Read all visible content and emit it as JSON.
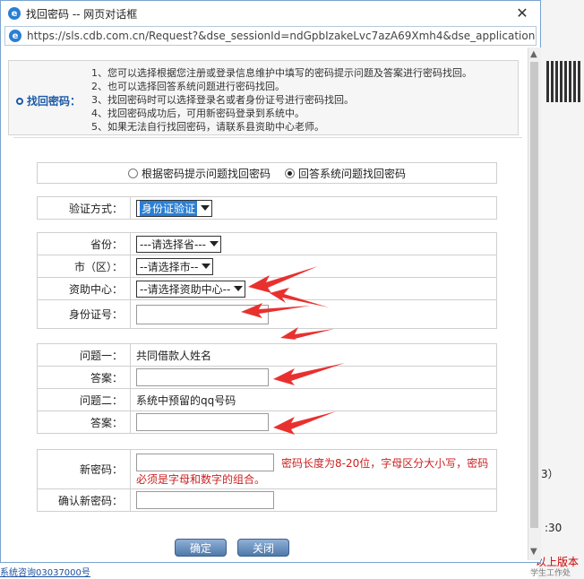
{
  "window": {
    "title": "找回密码 -- 网页对话框",
    "close_label": "✕",
    "url": "https://sls.cdb.com.cn/Request?&dse_sessionId=ndGpbIzakeLvc7azA69Xmh4&dse_applicationId="
  },
  "tips": {
    "label": "找回密码：",
    "items": [
      "1、您可以选择根据您注册或登录信息维护中填写的密码提示问题及答案进行密码找回。",
      "2、也可以选择回答系统问题进行密码找回。",
      "3、找回密码时可以选择登录名或者身份证号进行密码找回。",
      "4、找回密码成功后，可用新密码登录到系统中。",
      "5、如果无法自行找回密码，请联系县资助中心老师。"
    ]
  },
  "mode": {
    "option1": "根据密码提示问题找回密码",
    "option2": "回答系统问题找回密码",
    "selected": 2
  },
  "verify": {
    "label": "验证方式：",
    "value": "身份证验证"
  },
  "location": {
    "province_label": "省份：",
    "province_value": "---请选择省---",
    "city_label": "市（区）：",
    "city_value": "--请选择市--",
    "center_label": "资助中心：",
    "center_value": "--请选择资助中心--",
    "id_label": "身份证号："
  },
  "questions": {
    "q1_label": "问题一：",
    "q1_text": "共同借款人姓名",
    "a1_label": "答案：",
    "q2_label": "问题二：",
    "q2_text": "系统中预留的qq号码",
    "a2_label": "答案："
  },
  "password": {
    "new_label": "新密码：",
    "hint_line1": "密码长度为8-20位，字母区分大小写，密码",
    "hint_line2": "必须是字母和数字的组合。",
    "confirm_label": "确认新密码："
  },
  "buttons": {
    "ok": "确定",
    "close": "关闭"
  },
  "background": {
    "num": "3）",
    "time": ":30",
    "red_text": "以上版本",
    "gray_text": "学生工作处",
    "link_text": "系统咨询03037000号"
  },
  "colors": {
    "accent": "#1b5aa6",
    "hint_red": "#cc2020",
    "arrow_red": "#e8312f"
  }
}
